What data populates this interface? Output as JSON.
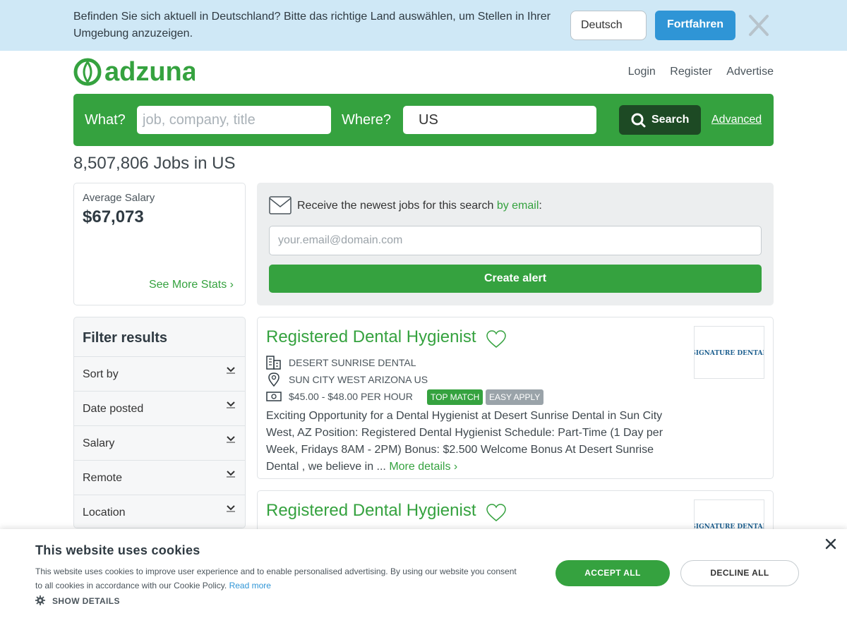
{
  "banner": {
    "text": "Befinden Sie sich aktuell in Deutschland? Bitte das richtige Land auswählen, um Stellen in Ihrer Umgebung anzuzeigen.",
    "country_select": "Deutsch",
    "continue_label": "Fortfahren"
  },
  "header": {
    "logo_text": "adzuna",
    "links": [
      "Login",
      "Register",
      "Advertise"
    ]
  },
  "search": {
    "what_label": "What?",
    "what_placeholder": "job, company, title",
    "where_label": "Where?",
    "where_value": "US",
    "button_label": "Search",
    "advanced_label": "Advanced"
  },
  "results": {
    "count_title": "8,507,806 Jobs in US"
  },
  "salary": {
    "label": "Average Salary",
    "value": "$67,073",
    "see_more": "See More Stats ›"
  },
  "alert": {
    "text": "Receive the newest jobs for this search",
    "link": "by email",
    "suffix": ":",
    "email_placeholder": "your.email@domain.com",
    "button_label": "Create alert"
  },
  "filter": {
    "title": "Filter results",
    "items": [
      "Sort by",
      "Date posted",
      "Salary",
      "Remote",
      "Location"
    ]
  },
  "jobs": [
    {
      "title": "Registered Dental Hygienist",
      "company": "DESERT SUNRISE DENTAL",
      "location": "SUN CITY WEST ARIZONA US",
      "salary": "$45.00 - $48.00 PER HOUR",
      "badges": [
        "TOP MATCH",
        "EASY APPLY"
      ],
      "description": "Exciting Opportunity for a Dental Hygienist at Desert Sunrise Dental in Sun City West, AZ Position: Registered Dental Hygienist Schedule: Part-Time (1 Day per Week, Fridays 8AM - 2PM) Bonus: $2.500 Welcome Bonus At Desert Sunrise Dental , we believe in ...",
      "more": "More details ›",
      "logo_text": "SIGNATURE DENTAL"
    },
    {
      "title": "Registered Dental Hygienist",
      "logo_text": "SIGNATURE DENTAL"
    }
  ],
  "cookie": {
    "title": "This website uses cookies",
    "text": "This website uses cookies to improve user experience and to enable personalised advertising. By using our website you consent to all cookies in accordance with our Cookie Policy.",
    "read_more": "Read more",
    "show_details": "SHOW DETAILS",
    "accept": "ACCEPT ALL",
    "decline": "DECLINE ALL"
  },
  "colors": {
    "brand_green": "#35a23f",
    "dark_green": "#1d4a24",
    "banner_blue": "#cfe8f6",
    "button_blue": "#2f95d6"
  },
  "icons": [
    "close-icon",
    "search-icon",
    "envelope-icon",
    "chevron-down-icon",
    "heart-icon",
    "building-icon",
    "location-pin-icon",
    "money-icon",
    "gear-icon"
  ]
}
